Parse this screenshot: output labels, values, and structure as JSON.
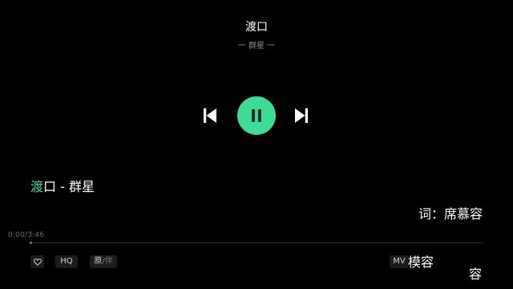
{
  "song": {
    "title": "渡口",
    "artist": "一 群星 一"
  },
  "controls": {
    "prev_icon": "skip-previous-icon",
    "play_pause_icon": "pause-icon",
    "next_icon": "skip-next-icon",
    "accent_color": "#3ddc97"
  },
  "lyrics": {
    "current_highlight": "渡",
    "current_rest": "口 - 群星",
    "credit": "词：席慕容",
    "overflow_line_1": "容",
    "overflow_line_2": "容"
  },
  "playback": {
    "time": "0:00/3:46",
    "progress": 0.0
  },
  "bottom_bar": {
    "like_icon": "heart-icon",
    "quality_label": "HQ",
    "original_label": "原",
    "accompaniment_label": "伴",
    "mv_label": "MV",
    "mv_overlap_text": "模"
  }
}
